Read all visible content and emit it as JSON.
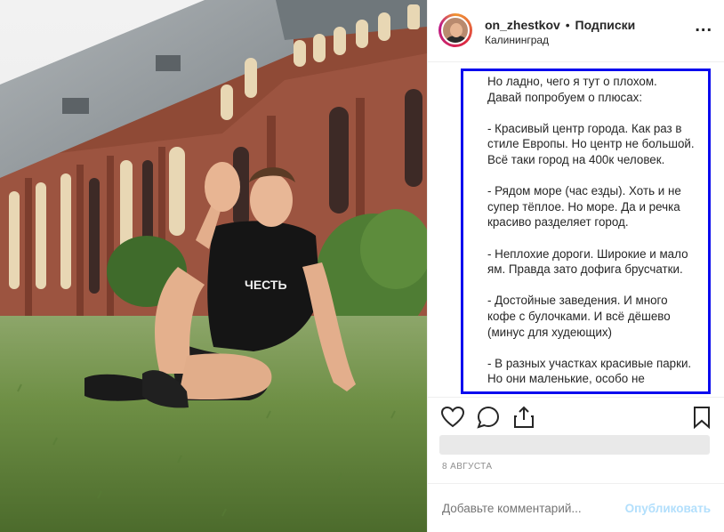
{
  "post": {
    "username": "on_zhestkov",
    "separator": "•",
    "follow_label": "Подписки",
    "location": "Калининград",
    "more_label": "...",
    "shirt_text": "ЧЕСТЬ",
    "caption": "Но ладно, чего я тут о плохом.\nДавай попробуем о плюсах:\n\n- Красивый центр города. Как раз в стиле Европы. Но центр не большой. Всё таки город на 400к человек.\n\n- Рядом море (час езды). Хоть и не супер тёплое. Но море. Да и речка красиво разделяет город.\n\n- Неплохие дороги. Широкие и мало ям. Правда зато дофига брусчатки.\n\n- Достойные заведения. И много кофе с булочками. И всё дёшево (минус для худеющих)\n\n- В разных участках красивые парки. Но они маленькие, особо не",
    "date": "8 АВГУСТА"
  },
  "actions": {
    "like_icon": "heart-icon",
    "comment_icon": "comment-icon",
    "share_icon": "share-icon",
    "save_icon": "bookmark-icon"
  },
  "comment": {
    "placeholder": "Добавьте комментарий...",
    "publish_label": "Опубликовать"
  },
  "colors": {
    "highlight_border": "#0a0aee",
    "publish_disabled": "#b2dffc",
    "muted_text": "#8e8e8e"
  }
}
